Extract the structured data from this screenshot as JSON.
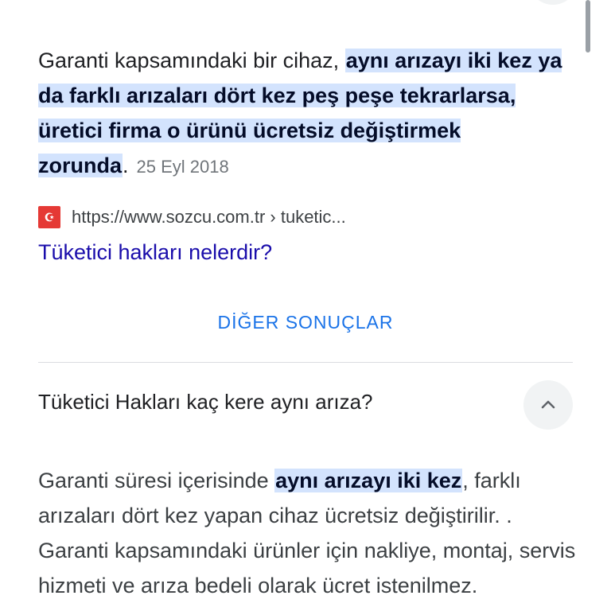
{
  "result1": {
    "snippet_pre": "Garanti kapsamındaki bir cihaz, ",
    "snippet_highlight": "aynı arızayı iki kez ya da farklı arızaları dört kez peş peşe tekrarlarsa, üretici firma o ürünü ücretsiz değiştirmek zorunda",
    "snippet_post": ".",
    "date": "25 Eyl 2018",
    "source_url": "https://www.sozcu.com.tr › tuketic...",
    "favicon_text": "☪",
    "link_title": "Tüketici hakları nelerdir?"
  },
  "more_results_label": "DİĞER SONUÇLAR",
  "question": {
    "text": "Tüketici Hakları kaç kere aynı arıza?",
    "answer_pre": "Garanti süresi içerisinde ",
    "answer_highlight": "aynı arızayı iki kez",
    "answer_post": ", farklı arızaları dört kez yapan cihaz ücretsiz değiştirilir. . Garanti kapsamındaki ürünler için nakliye, montaj, servis hizmeti ve arıza bedeli olarak ücret istenilmez."
  }
}
